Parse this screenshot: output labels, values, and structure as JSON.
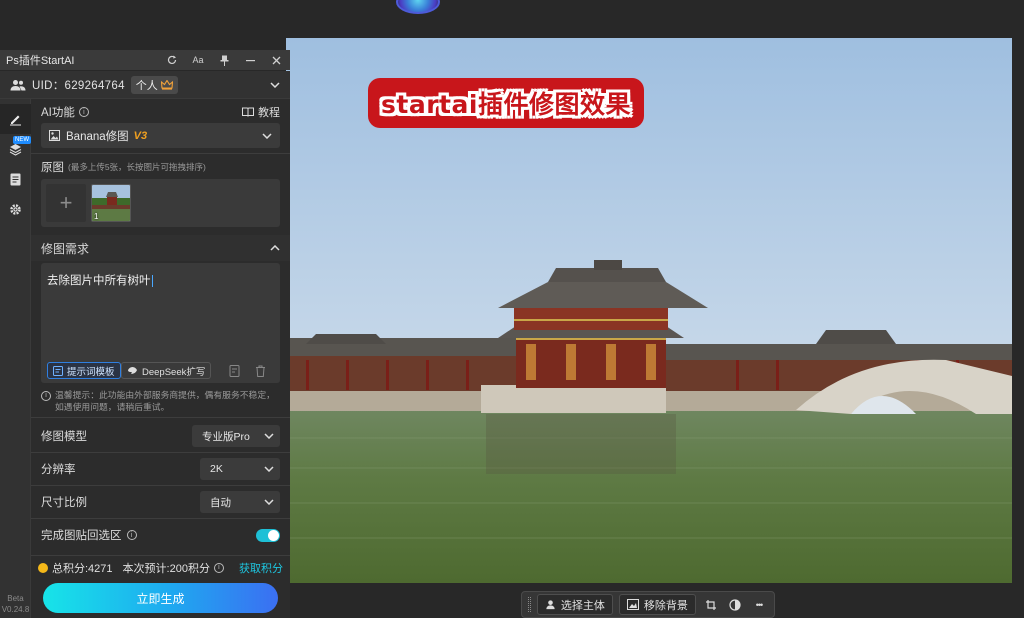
{
  "panel": {
    "title": "Ps插件StartAI",
    "uid_label": "UID：629264764",
    "account_type": "个人",
    "ai_function_label": "AI功能",
    "tutorial_label": "教程",
    "model_select": {
      "value": "Banana修图",
      "badge": "V3"
    },
    "source_label": "原图",
    "source_hint": "(最多上传5张，长按图片可拖拽排序)",
    "thumbnail_index": "1",
    "request_label": "修图需求",
    "request_text": "去除图片中所有树叶",
    "prompt_template_button": "提示词模板",
    "deepseek_button": "DeepSeek扩写",
    "warning_text": "温馨提示：此功能由外部服务商提供，偶有服务不稳定，如遇使用问题，请稍后重试。",
    "settings": [
      {
        "label": "修图模型",
        "value": "专业版Pro"
      },
      {
        "label": "分辨率",
        "value": "2K"
      },
      {
        "label": "尺寸比例",
        "value": "自动"
      }
    ],
    "paste_back_label": "完成图贴回选区",
    "paste_back_enabled": true,
    "total_credits": "总积分:4271",
    "estimated_cost": "本次预计:200积分",
    "get_credits": "获取积分",
    "generate_button": "立即生成"
  },
  "rail": {
    "new_badge": "NEW",
    "version_line1": "Beta",
    "version_line2": "V0.24.8"
  },
  "canvas": {
    "watermark_text": "startai插件修图效果"
  },
  "bottom_toolbar": {
    "select_subject": "选择主体",
    "remove_background": "移除背景",
    "more": "•••"
  },
  "colors": {
    "accent_cyan": "#1ec6e0",
    "watermark_red": "#c8161b",
    "badge_orange": "#f0a020"
  }
}
